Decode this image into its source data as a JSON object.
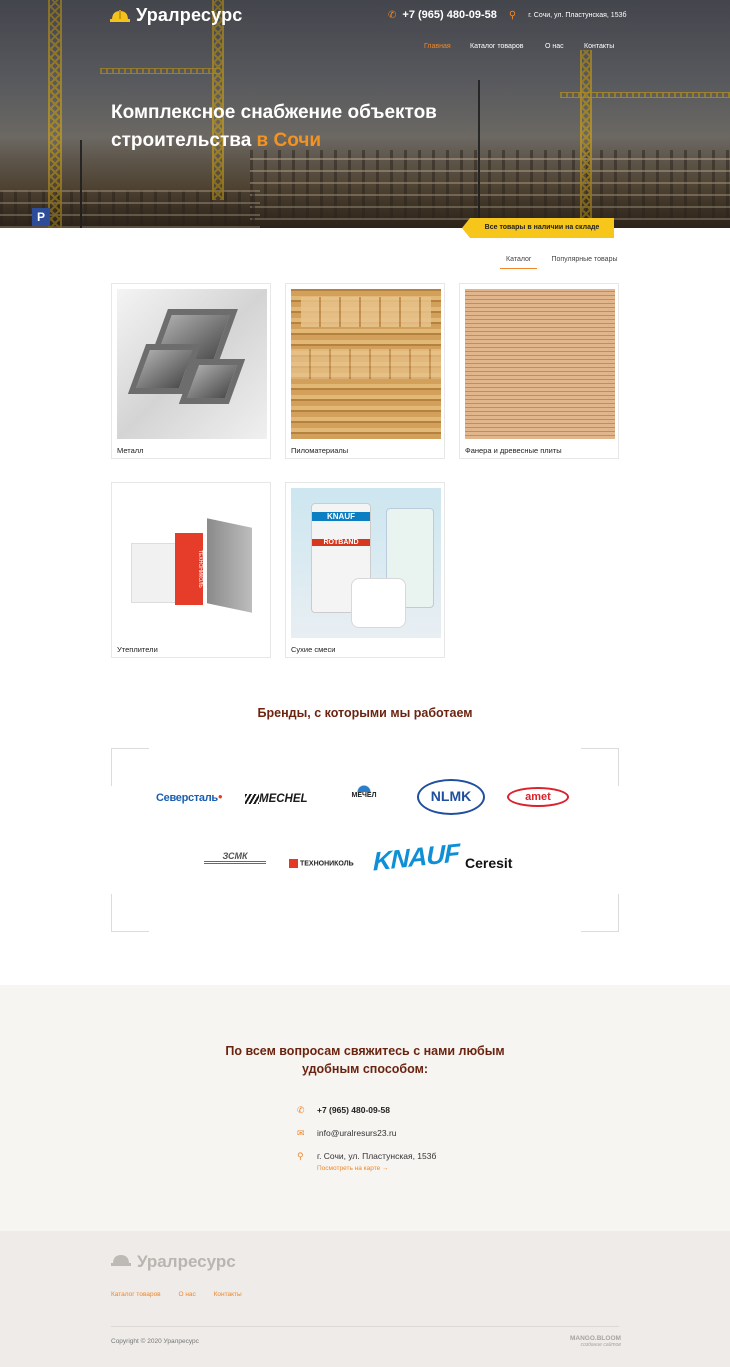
{
  "header": {
    "logo_text": "Уралресурс",
    "phone": "+7 (965) 480-09-58",
    "address": "г. Сочи, ул. Пластунская, 153б",
    "nav": [
      {
        "label": "Главная",
        "active": true
      },
      {
        "label": "Каталог товаров",
        "active": false
      },
      {
        "label": "О нас",
        "active": false
      },
      {
        "label": "Контакты",
        "active": false
      }
    ]
  },
  "hero": {
    "title_line1": "Комплексное снабжение объектов",
    "title_line2_prefix": "строительства ",
    "title_line2_accent": "в Сочи",
    "parking_sign": "P",
    "instock_badge": "Все товары в наличии на складе"
  },
  "tabs": [
    {
      "label": "Каталог",
      "active": true
    },
    {
      "label": "Популярные товары",
      "active": false
    }
  ],
  "catalog": [
    {
      "label": "Металл",
      "image": "metal-pipes"
    },
    {
      "label": "Пиломатериалы",
      "image": "lumber"
    },
    {
      "label": "Фанера и древесные плиты",
      "image": "plywood"
    },
    {
      "label": "Утеплители",
      "image": "insulation"
    },
    {
      "label": "Сухие смеси",
      "image": "dry-mixes"
    }
  ],
  "product_image_text": {
    "insulation_brand": "ТЕХНОНИКОЛЬ",
    "mix_brand": "KNAUF",
    "mix_product": "ROTBAND"
  },
  "brands": {
    "title": "Бренды, с которыми мы работаем",
    "row1": [
      "Северсталь",
      "MECHEL",
      "МЕЧЕЛ",
      "NLMK",
      "amet"
    ],
    "row2": [
      "ЗСМК",
      "ТЕХНОНИКОЛЬ",
      "KNAUF",
      "Ceresit"
    ]
  },
  "contact": {
    "title_line1": "По всем вопросам свяжитесь с нами любым",
    "title_line2": "удобным способом:",
    "phone": "+7 (965) 480-09-58",
    "email": "info@uralresurs23.ru",
    "address": "г. Сочи, ул. Пластунская, 153б",
    "map_link": "Посмотреть на карте →"
  },
  "footer": {
    "logo_text": "Уралресурс",
    "links": [
      "Каталог товаров",
      "О нас",
      "Контакты"
    ],
    "copyright": "Copyright © 2020 Уралресурс",
    "developer_line1": "MANGO.BLOOM",
    "developer_line2": "создание сайтов"
  },
  "colors": {
    "accent_orange": "#f0872a",
    "badge_yellow": "#f6c61b",
    "title_brown": "#6b2410"
  }
}
